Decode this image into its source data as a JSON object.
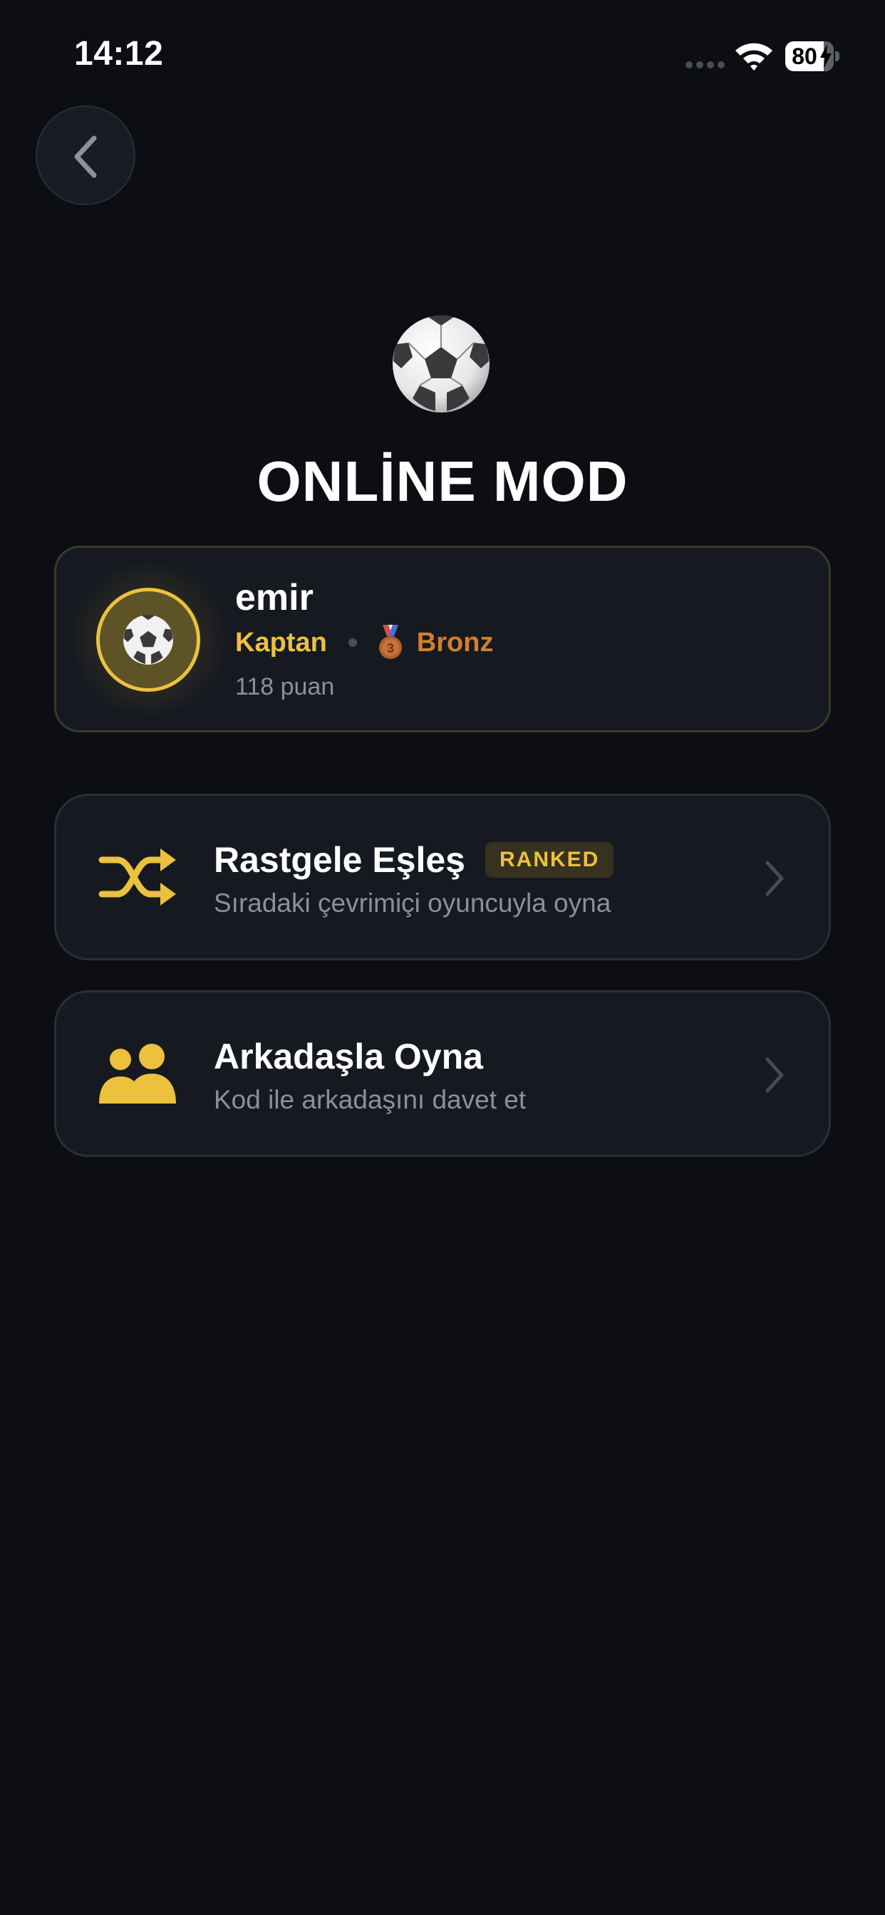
{
  "status_bar": {
    "time": "14:12",
    "battery_level": "80",
    "icons": [
      "cellular-signal-icon",
      "wifi-icon",
      "battery-charging-icon"
    ]
  },
  "navigation": {
    "back_icon": "chevron-left-icon"
  },
  "hero": {
    "icon": "soccer-ball-icon",
    "title": "ONLİNE MOD"
  },
  "profile": {
    "avatar_icon": "soccer-ball-icon",
    "name": "emir",
    "role": "Kaptan",
    "rank_icon": "third-place-medal-icon",
    "rank": "Bronz",
    "points": "118 puan"
  },
  "menu": [
    {
      "icon": "shuffle-icon",
      "title": "Rastgele Eşleş",
      "badge": "RANKED",
      "subtitle": "Sıradaki çevrimiçi oyuncuyla oyna"
    },
    {
      "icon": "users-icon",
      "title": "Arkadaşla Oyna",
      "subtitle": "Kod ile arkadaşını davet et"
    }
  ],
  "colors": {
    "background": "#0c0e14",
    "card": "#161920",
    "accent_gold": "#ecc13e",
    "bronze": "#d07f2e",
    "muted_text": "#8c909b"
  }
}
